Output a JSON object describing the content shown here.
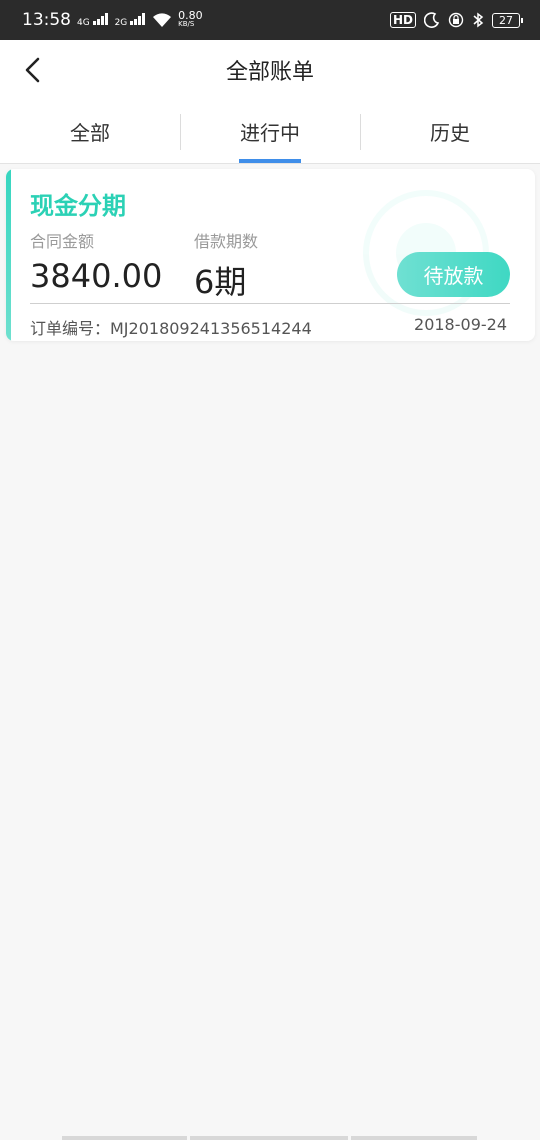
{
  "status_bar": {
    "time": "13:58",
    "net1": "4G",
    "net2": "2G",
    "speed_value": "0.80",
    "speed_unit": "KB/S",
    "hd_label": "HD",
    "battery": "27"
  },
  "nav": {
    "title": "全部账单"
  },
  "tabs": [
    {
      "label": "全部"
    },
    {
      "label": "进行中"
    },
    {
      "label": "历史"
    }
  ],
  "active_tab": "进行中",
  "card": {
    "title": "现金分期",
    "amount_label": "合同金额",
    "periods_label": "借款期数",
    "amount_value": "3840.00",
    "periods_value": "6期",
    "status": "待放款",
    "order_number": "订单编号：MJ201809241356514244",
    "date": "2018-09-24"
  },
  "colors": {
    "accent": "#2bd1b5",
    "tab_active": "#3f8ee9",
    "status_bar": "#2b2b2b"
  }
}
